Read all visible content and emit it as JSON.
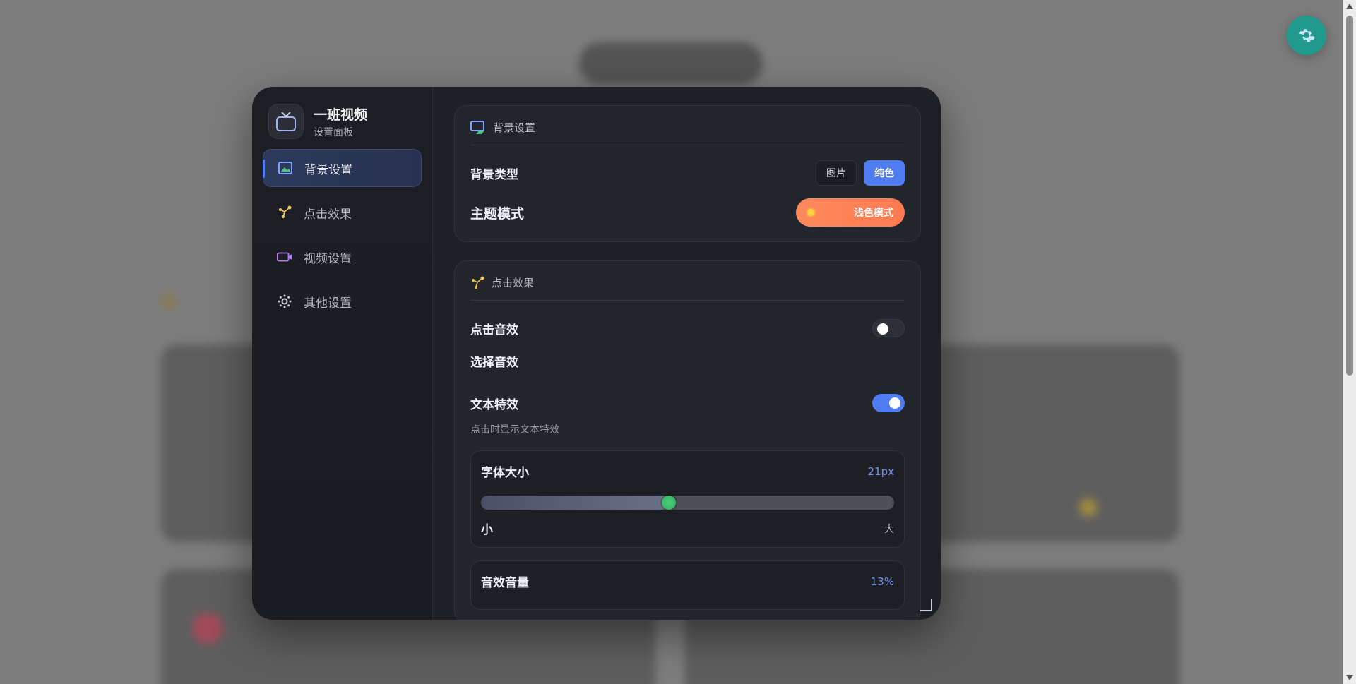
{
  "app": {
    "name": "一班视频",
    "subtitle": "设置面板"
  },
  "sidebar": {
    "items": [
      {
        "label": "背景设置",
        "icon": "image-icon",
        "active": true
      },
      {
        "label": "点击效果",
        "icon": "click-effect-icon",
        "active": false
      },
      {
        "label": "视频设置",
        "icon": "video-icon",
        "active": false
      },
      {
        "label": "其他设置",
        "icon": "gear-icon",
        "active": false
      }
    ]
  },
  "background_section": {
    "title": "背景设置",
    "type_label": "背景类型",
    "type_options": [
      "图片",
      "纯色"
    ],
    "type_selected": "纯色",
    "theme_label": "主题模式",
    "theme_value": "浅色模式"
  },
  "click_section": {
    "title": "点击效果",
    "sound_label": "点击音效",
    "sound_enabled": false,
    "choose_sound_label": "选择音效",
    "text_effect_label": "文本特效",
    "text_effect_enabled": true,
    "text_effect_desc": "点击时显示文本特效",
    "font_size": {
      "label": "字体大小",
      "value_text": "21px",
      "fraction": 0.455,
      "min_label": "小",
      "max_label": "大"
    },
    "volume": {
      "label": "音效音量",
      "value_text": "13%"
    }
  },
  "colors": {
    "accent": "#4f7cf0",
    "theme_pill": "#ff8a5c",
    "slider_thumb": "#3cc06c",
    "fab": "#1f9a8c"
  }
}
